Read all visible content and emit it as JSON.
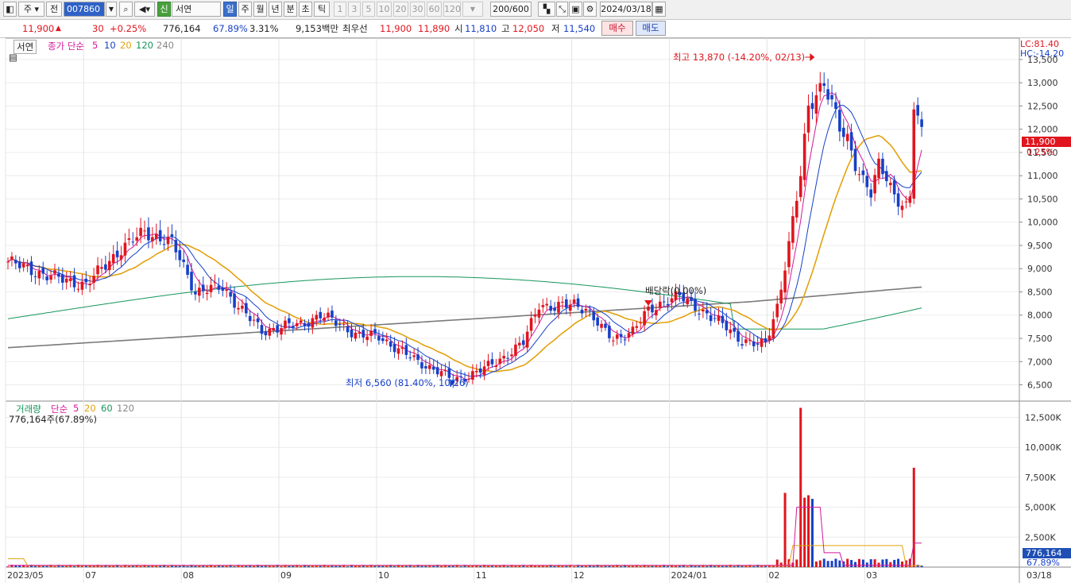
{
  "toolbar": {
    "type_label": "주",
    "type_sel": "전",
    "code": "007860",
    "badge_new": "신",
    "name": "서연",
    "periods": [
      "일",
      "주",
      "월",
      "년",
      "분",
      "초",
      "틱"
    ],
    "minutes": [
      "1",
      "3",
      "5",
      "10",
      "20",
      "30",
      "60",
      "120"
    ],
    "count": "200/600",
    "date": "2024/03/18"
  },
  "quote": {
    "price": "11,900",
    "change": "30",
    "change_pct": "+0.25%",
    "volume": "776,164",
    "volume_ratio": "67.89%",
    "turnover": "3.31%",
    "amount": "9,153백만",
    "best_label": "최우선",
    "best_ask": "11,900",
    "best_bid": "11,890",
    "open_label": "시",
    "open": "11,810",
    "high_label": "고",
    "high": "12,050",
    "low_label": "저",
    "low": "11,540",
    "buy_label": "매수",
    "sell_label": "매도"
  },
  "colors": {
    "up": "#e0151e",
    "down": "#1740c8",
    "ma5": "#d5189a",
    "ma10": "#1740c8",
    "ma20": "#e3a20e",
    "ma120": "#16965a",
    "ma240": "#7a7a7a"
  },
  "price_panel": {
    "tab": "서연",
    "legend_title": "종가 단순",
    "periods": [
      "5",
      "10",
      "20",
      "120",
      "240"
    ],
    "lc": "LC:81.40",
    "hc": "HC:-14.20",
    "current_price_tag": "11,900",
    "current_pct_tag": "0.25%",
    "high_note": "최고 13,870 (-14.20%, 02/13)",
    "low_note": "최저 6,560 (81.40%, 10/26)",
    "dividend_note": "배당락(0.00%)"
  },
  "volume_panel": {
    "legend_title": "거래량",
    "legend_sub": "단순",
    "periods": [
      "5",
      "20",
      "60",
      "120"
    ],
    "current": "776,164주(67.89%)",
    "tag_value": "776,164",
    "tag_pct": "67.89%"
  },
  "chart_data": {
    "type": "candlestick",
    "y_ticks": [
      "6,500",
      "7,000",
      "7,500",
      "8,000",
      "8,500",
      "9,000",
      "9,500",
      "10,000",
      "10,500",
      "11,000",
      "11,500",
      "12,000",
      "12,500",
      "13,000",
      "13,500"
    ],
    "y_range": [
      6150,
      13960
    ],
    "volume_ticks": [
      "2,500K",
      "5,000K",
      "7,500K",
      "10,000K",
      "12,500K"
    ],
    "volume_range": [
      0,
      13000
    ],
    "x_labels": [
      "2023/05",
      "07",
      "08",
      "09",
      "10",
      "11",
      "12",
      "2024/01",
      "02",
      "03",
      "03/18"
    ],
    "x_label_index": [
      0,
      20,
      45,
      70,
      95,
      120,
      145,
      170,
      195,
      220,
      236
    ],
    "anchors_close": [
      [
        0,
        9150
      ],
      [
        10,
        8850
      ],
      [
        20,
        8650
      ],
      [
        28,
        9350
      ],
      [
        35,
        9800
      ],
      [
        42,
        9550
      ],
      [
        45,
        9050
      ],
      [
        48,
        8500
      ],
      [
        55,
        8600
      ],
      [
        60,
        8100
      ],
      [
        65,
        7650
      ],
      [
        70,
        7750
      ],
      [
        75,
        7800
      ],
      [
        80,
        8000
      ],
      [
        85,
        7800
      ],
      [
        90,
        7550
      ],
      [
        95,
        7550
      ],
      [
        100,
        7250
      ],
      [
        105,
        7000
      ],
      [
        110,
        6800
      ],
      [
        114,
        6600
      ],
      [
        118,
        6700
      ],
      [
        122,
        6850
      ],
      [
        127,
        7100
      ],
      [
        132,
        7400
      ],
      [
        136,
        8250
      ],
      [
        140,
        8150
      ],
      [
        145,
        8250
      ],
      [
        148,
        8150
      ],
      [
        152,
        7700
      ],
      [
        155,
        7500
      ],
      [
        160,
        7650
      ],
      [
        164,
        8100
      ],
      [
        168,
        8300
      ],
      [
        172,
        8400
      ],
      [
        176,
        8200
      ],
      [
        180,
        7950
      ],
      [
        184,
        7750
      ],
      [
        188,
        7450
      ],
      [
        192,
        7350
      ],
      [
        194,
        7400
      ],
      [
        197,
        8200
      ],
      [
        200,
        9500
      ],
      [
        203,
        11000
      ],
      [
        205,
        12500
      ],
      [
        207,
        12800
      ],
      [
        209,
        13000
      ],
      [
        211,
        12500
      ],
      [
        213,
        12000
      ],
      [
        215,
        11800
      ],
      [
        217,
        11300
      ],
      [
        219,
        10900
      ],
      [
        221,
        10600
      ],
      [
        223,
        11200
      ],
      [
        225,
        11000
      ],
      [
        227,
        10600
      ],
      [
        229,
        10400
      ],
      [
        230,
        10300
      ],
      [
        231,
        10500
      ],
      [
        232,
        12500
      ],
      [
        233,
        12200
      ],
      [
        234,
        11900
      ]
    ],
    "vol_spikes": [
      [
        199,
        6200
      ],
      [
        203,
        13300
      ],
      [
        204,
        5800
      ],
      [
        205,
        6000
      ],
      [
        206,
        5700
      ],
      [
        232,
        8300
      ]
    ],
    "candle_count": 235
  }
}
